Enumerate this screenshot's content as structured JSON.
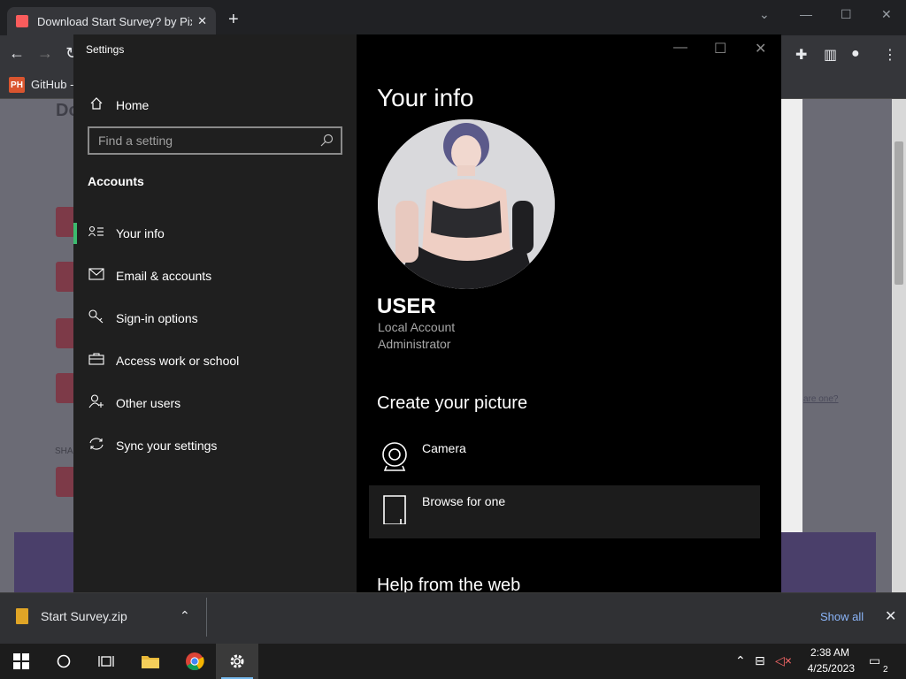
{
  "browser": {
    "tab_title": "Download Start Survey? by Pix",
    "bookmark_label": "GitHub -",
    "bookmark_icon_text": "PH"
  },
  "webpage": {
    "heading": "Do",
    "small_text": "SHA",
    "link_text": "are one?"
  },
  "settings": {
    "window_title": "Settings",
    "home_label": "Home",
    "search_placeholder": "Find a setting",
    "section_label": "Accounts",
    "nav_items": [
      {
        "label": "Your info",
        "icon": "person-card-icon",
        "active": true
      },
      {
        "label": "Email & accounts",
        "icon": "mail-icon",
        "active": false
      },
      {
        "label": "Sign-in options",
        "icon": "key-icon",
        "active": false
      },
      {
        "label": "Access work or school",
        "icon": "briefcase-icon",
        "active": false
      },
      {
        "label": "Other users",
        "icon": "add-person-icon",
        "active": false
      },
      {
        "label": "Sync your settings",
        "icon": "sync-icon",
        "active": false
      }
    ],
    "page_heading": "Your info",
    "username": "USER",
    "account_type": "Local Account",
    "account_role": "Administrator",
    "create_picture_heading": "Create your picture",
    "camera_label": "Camera",
    "browse_label": "Browse for one",
    "help_heading": "Help from the web"
  },
  "download": {
    "file_name": "Start Survey.zip",
    "show_all": "Show all"
  },
  "taskbar": {
    "time": "2:38 AM",
    "date": "4/25/2023",
    "notification_count": "2"
  },
  "colors": {
    "accent_green": "#3bba6e",
    "settings_sidebar": "#1f1f1f",
    "chrome_dark": "#202124"
  }
}
